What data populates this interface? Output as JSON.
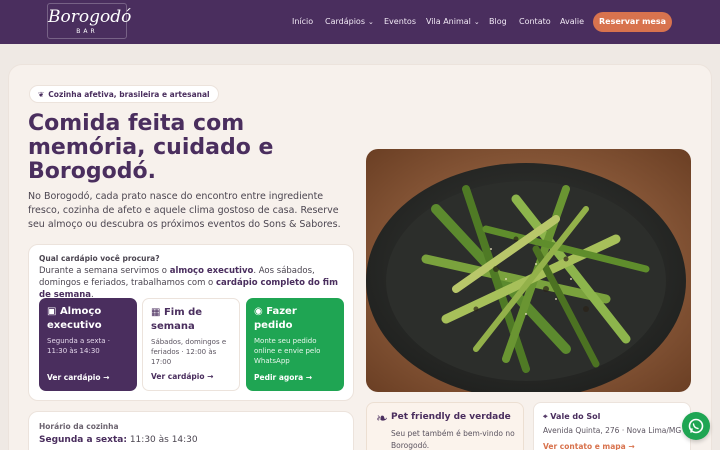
{
  "brand": {
    "name": "Borogodó",
    "subtitle": "BAR"
  },
  "nav": {
    "items": [
      {
        "label": "Início"
      },
      {
        "label": "Cardápios"
      },
      {
        "label": "Eventos"
      },
      {
        "label": "Vila Animal"
      },
      {
        "label": "Blog"
      },
      {
        "label": "Contato"
      },
      {
        "label": "Avalie"
      }
    ],
    "cta": "Reservar mesa"
  },
  "hero": {
    "tag_icon": "leaf-icon",
    "tag": "Cozinha afetiva, brasileira e artesanal",
    "headline": "Comida feita com memória, cuidado e Borogodó.",
    "lead": "No Borogodó, cada prato nasce do encontro entre ingrediente fresco, cozinha de afeto e aquele clima gostoso de casa. Reserve seu almoço ou descubra os próximos eventos do Sons & Sabores."
  },
  "menu_picker": {
    "question": "Qual cardápio você procura?",
    "desc_1": "Durante a semana servimos o ",
    "desc_b1": "almoço executivo",
    "desc_2": ". Aos sábados, domingos e feriados, trabalhamos com o ",
    "desc_b2": "cardápio completo do fim de semana",
    "desc_3": ".",
    "options": [
      {
        "icon": "briefcase-icon",
        "title": "Almoço executivo",
        "text": "Segunda a sexta · 11:30 às 14:30",
        "link": "Ver cardápio →"
      },
      {
        "icon": "calendar-icon",
        "title": "Fim de semana",
        "text": "Sábados, domingos e feriados · 12:00 às 17:00",
        "link": "Ver cardápio →"
      },
      {
        "icon": "whatsapp-icon",
        "title": "Fazer pedido",
        "text": "Monte seu pedido online e envie pelo WhatsApp",
        "link": "Pedir agora →"
      }
    ]
  },
  "hours": {
    "label": "Horário da cozinha",
    "day": "Segunda a sexta:",
    "time": "11:30 às 14:30"
  },
  "pet": {
    "icon": "paw-icon",
    "title": "Pet friendly de verdade",
    "text": "Seu pet também é bem-vindo no Borogodó."
  },
  "location": {
    "icon": "map-pin-icon",
    "title": "Vale do Sol",
    "address": "Avenida Quinta, 276 · Nova Lima/MG",
    "link": "Ver contato e mapa →"
  },
  "colors": {
    "brand_purple": "#4a2e5e",
    "accent_orange": "#d8734e",
    "whatsapp_green": "#1fa553",
    "background": "#efe9e4"
  }
}
